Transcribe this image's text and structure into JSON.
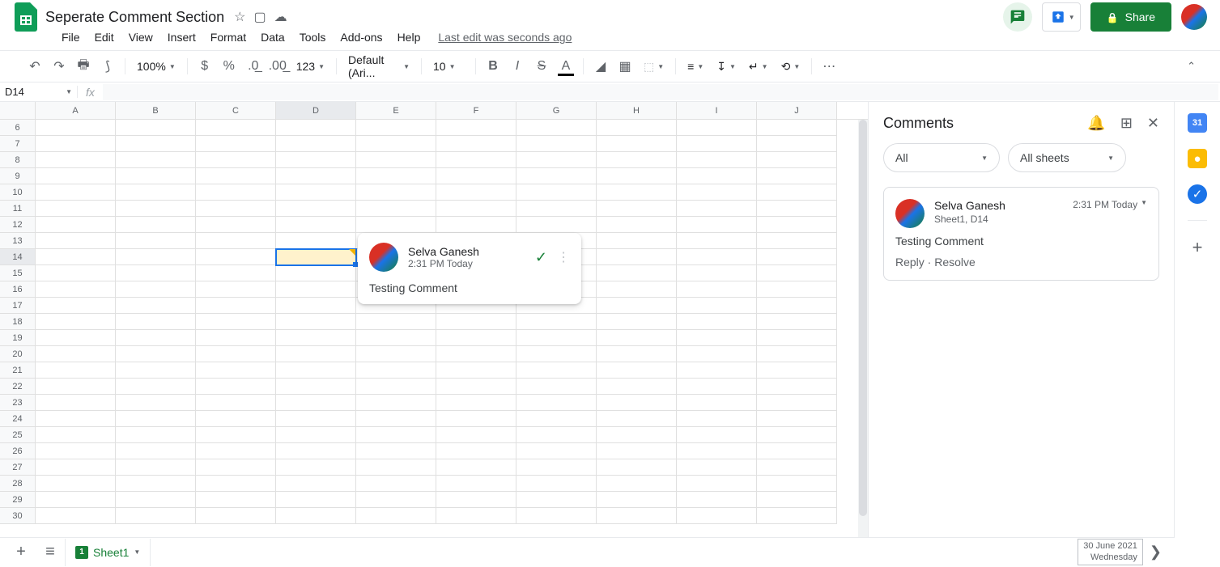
{
  "doc": {
    "title": "Seperate Comment Section",
    "last_edit": "Last edit was seconds ago"
  },
  "menus": [
    "File",
    "Edit",
    "View",
    "Insert",
    "Format",
    "Data",
    "Tools",
    "Add-ons",
    "Help"
  ],
  "toolbar": {
    "zoom": "100%",
    "font": "Default (Ari...",
    "font_size": "10",
    "more_formats": "123"
  },
  "share_label": "Share",
  "name_box": "D14",
  "grid": {
    "columns": [
      "A",
      "B",
      "C",
      "D",
      "E",
      "F",
      "G",
      "H",
      "I",
      "J"
    ],
    "row_start": 6,
    "row_end": 30,
    "selected_col": "D",
    "selected_row": 14
  },
  "inline_comment": {
    "author": "Selva Ganesh",
    "time": "2:31 PM Today",
    "text": "Testing Comment"
  },
  "comments_panel": {
    "title": "Comments",
    "filter1": "All",
    "filter2": "All sheets",
    "card": {
      "author": "Selva Ganesh",
      "location": "Sheet1, D14",
      "time": "2:31 PM Today",
      "text": "Testing Comment",
      "reply": "Reply",
      "resolve": "Resolve"
    }
  },
  "rail": {
    "calendar_day": "31"
  },
  "tabs": {
    "sheet_badge": "1",
    "sheet_name": "Sheet1",
    "date_line1": "30 June 2021",
    "date_line2": "Wednesday"
  }
}
